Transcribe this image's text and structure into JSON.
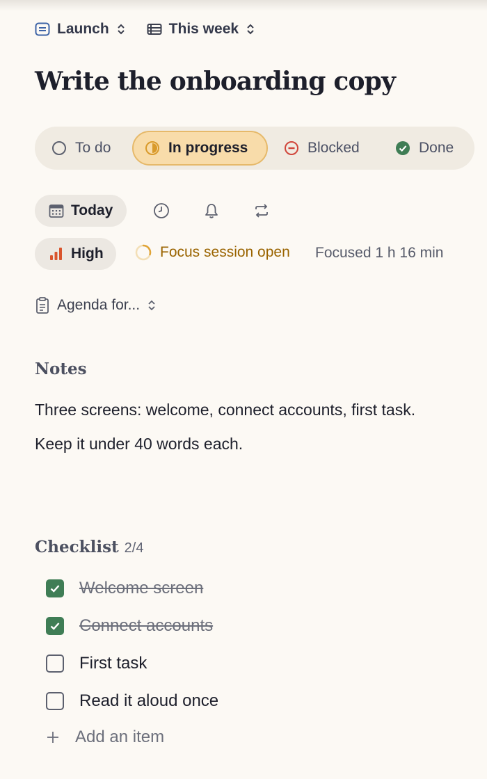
{
  "breadcrumbs": [
    {
      "label": "Launch",
      "icon": "list-icon"
    },
    {
      "label": "This week",
      "icon": "calendar-view-icon"
    }
  ],
  "task": {
    "title": "Write the onboarding copy"
  },
  "status": {
    "options": [
      {
        "label": "To do",
        "icon": "circle-icon"
      },
      {
        "label": "In progress",
        "icon": "half-circle-icon",
        "active": true
      },
      {
        "label": "Blocked",
        "icon": "blocked-icon"
      },
      {
        "label": "Done",
        "icon": "check-circle-icon"
      }
    ],
    "selected": "In progress"
  },
  "schedule": {
    "date_label": "Today",
    "tools": [
      "clock-icon",
      "bell-icon",
      "repeat-icon"
    ]
  },
  "priority": {
    "label": "High",
    "icon": "bars-icon"
  },
  "focus": {
    "session_label": "Focus session open",
    "focused_text": "Focused 1 h 16 min"
  },
  "agenda": {
    "label": "Agenda for...",
    "icon": "clipboard-icon"
  },
  "notes": {
    "heading": "Notes",
    "lines": [
      "Three screens: welcome, connect accounts, first task.",
      "Keep it under 40 words each."
    ]
  },
  "checklist": {
    "heading": "Checklist",
    "count": "2/4",
    "items": [
      {
        "label": "Welcome screen",
        "checked": true
      },
      {
        "label": "Connect accounts",
        "checked": true
      },
      {
        "label": "First task",
        "checked": false
      },
      {
        "label": "Read it aloud once",
        "checked": false
      }
    ],
    "add_label": "Add an item"
  },
  "colors": {
    "background": "#fcf9f4",
    "accent_in_progress": "#d99a2b",
    "blocked": "#d0453a",
    "done": "#3f7d55",
    "priority_high": "#d9542c",
    "focus_text": "#9a6400"
  }
}
